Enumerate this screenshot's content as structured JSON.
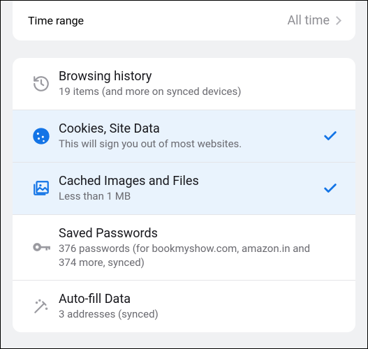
{
  "timeRange": {
    "label": "Time range",
    "value": "All time"
  },
  "items": [
    {
      "title": "Browsing history",
      "sub": "19 items (and more on synced devices)"
    },
    {
      "title": "Cookies, Site Data",
      "sub": "This will sign you out of most websites."
    },
    {
      "title": "Cached Images and Files",
      "sub": "Less than 1 MB"
    },
    {
      "title": "Saved Passwords",
      "sub": "376 passwords (for bookmyshow.com, amazon.in and 374 more, synced)"
    },
    {
      "title": "Auto-fill Data",
      "sub": "3 addresses (synced)"
    }
  ]
}
